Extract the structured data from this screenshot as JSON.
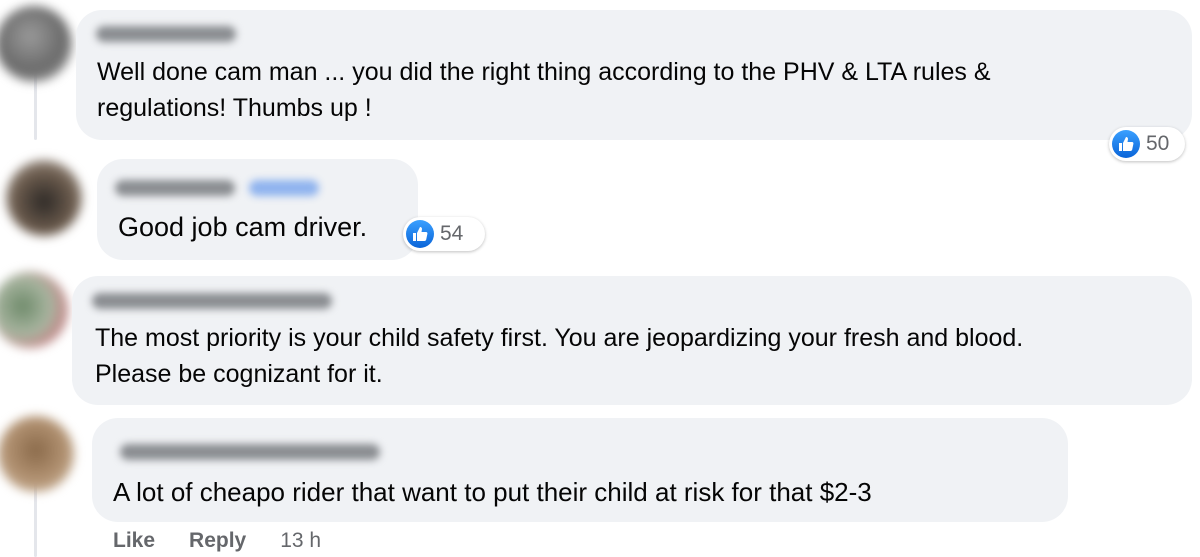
{
  "comments": [
    {
      "text_line1": "Well done cam man ... you did the right thing according to the PHV & LTA rules &",
      "text_line2": "regulations! Thumbs up !",
      "reaction_count": "50"
    },
    {
      "text_line1": "Good job cam driver.",
      "reaction_count": "54"
    },
    {
      "text_line1": "The most priority is your child safety first. You are jeopardizing your fresh and blood.",
      "text_line2": "Please be cognizant for it."
    },
    {
      "text_line1": "A lot of cheapo rider that want to put their child at risk for that $2-3"
    }
  ],
  "actions": {
    "like": "Like",
    "reply": "Reply",
    "timestamp": "13 h"
  },
  "colors": {
    "bubble": "#f0f2f5",
    "like_blue": "#1877f2",
    "meta_text": "#65676b"
  },
  "icons": {
    "reaction": "thumbs-up-like-icon"
  }
}
